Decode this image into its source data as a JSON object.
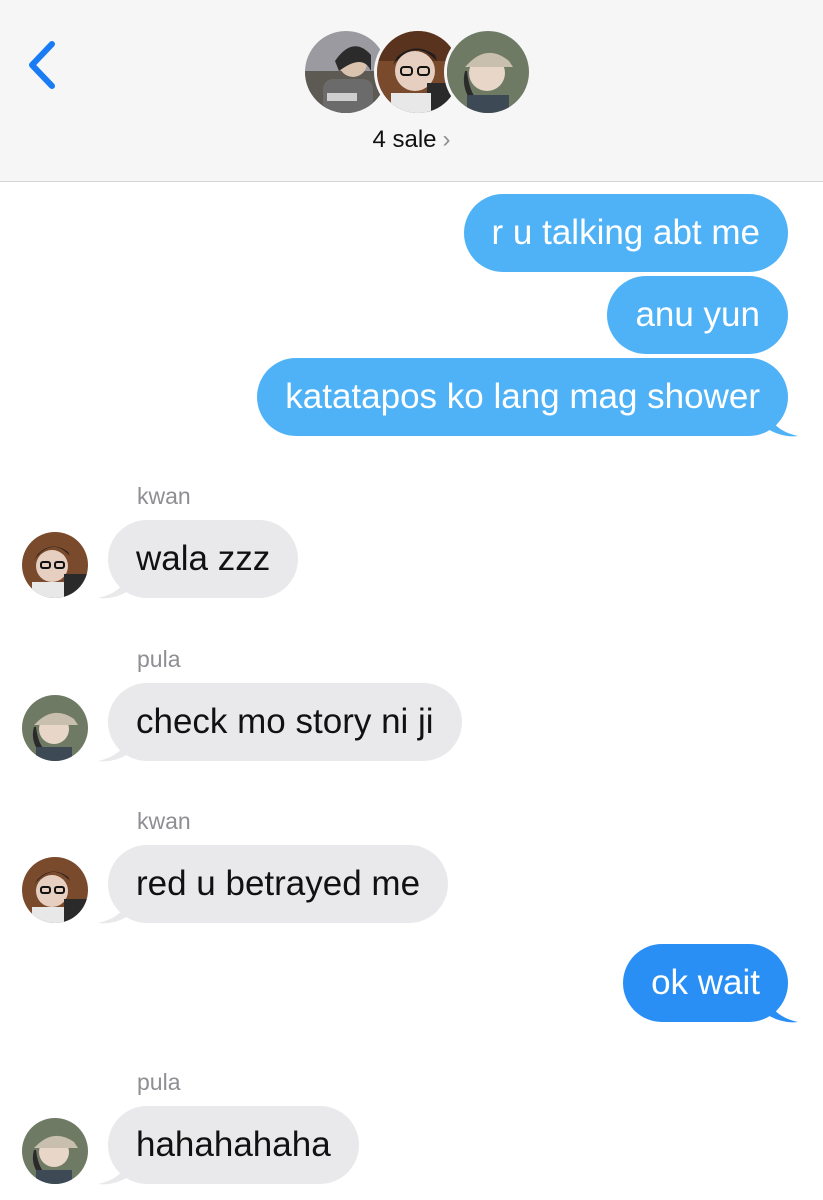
{
  "header": {
    "group_name": "4 sale",
    "chevron": "›",
    "back_icon": "chevron-left-icon"
  },
  "colors": {
    "outgoing": "#4fb2f7",
    "outgoing_latest": "#2a8ff5",
    "incoming": "#e9e9eb",
    "back_accent": "#1a7cf5"
  },
  "messages": [
    {
      "from": "me",
      "text": "r u talking abt me"
    },
    {
      "from": "me",
      "text": "anu yun"
    },
    {
      "from": "me",
      "text": "katatapos ko lang mag shower"
    },
    {
      "from": "kwan",
      "sender_label": "kwan",
      "text": "wala zzz"
    },
    {
      "from": "pula",
      "sender_label": "pula",
      "text": "check mo story ni ji"
    },
    {
      "from": "kwan",
      "sender_label": "kwan",
      "text": "red u betrayed me"
    },
    {
      "from": "me",
      "text": "ok wait"
    },
    {
      "from": "pula",
      "sender_label": "pula",
      "text": "hahahahaha"
    }
  ]
}
